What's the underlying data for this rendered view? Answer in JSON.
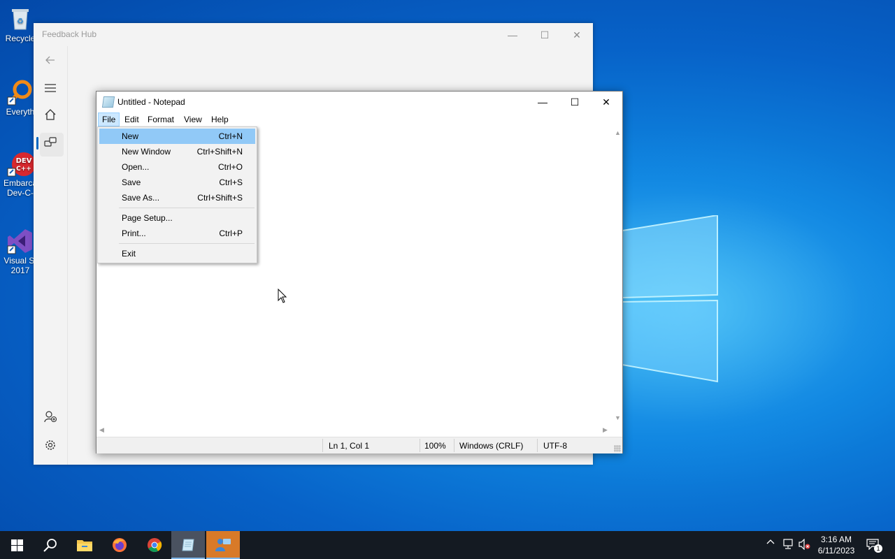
{
  "desktop": {
    "icons": [
      {
        "label": "Recycle",
        "icon": "recycle-bin-icon"
      },
      {
        "label": "Everyth",
        "icon": "everything-search-icon"
      },
      {
        "label": "Embarca",
        "label2": "Dev-C-",
        "icon": "devcpp-icon"
      },
      {
        "label": "Visual St",
        "label2": "2017",
        "icon": "visual-studio-icon"
      }
    ]
  },
  "feedback_hub": {
    "title": "Feedback Hub",
    "controls": {
      "minimize": "—",
      "maximize": "☐",
      "close": "✕"
    },
    "nav_icons": [
      "back-arrow-icon",
      "hamburger-menu-icon",
      "home-icon",
      "feedback-icon",
      "add-person-icon",
      "settings-gear-icon"
    ]
  },
  "notepad": {
    "title": "Untitled - Notepad",
    "controls": {
      "minimize": "—",
      "maximize": "☐",
      "close": "✕"
    },
    "menu": [
      "File",
      "Edit",
      "Format",
      "View",
      "Help"
    ],
    "active_menu": "File",
    "status": {
      "position": "Ln 1, Col 1",
      "zoom": "100%",
      "line_ending": "Windows (CRLF)",
      "encoding": "UTF-8"
    }
  },
  "file_menu": {
    "items": [
      {
        "label": "New",
        "shortcut": "Ctrl+N",
        "highlighted": true
      },
      {
        "label": "New Window",
        "shortcut": "Ctrl+Shift+N"
      },
      {
        "label": "Open...",
        "shortcut": "Ctrl+O"
      },
      {
        "label": "Save",
        "shortcut": "Ctrl+S"
      },
      {
        "label": "Save As...",
        "shortcut": "Ctrl+Shift+S"
      },
      {
        "label": "Page Setup...",
        "shortcut": ""
      },
      {
        "label": "Print...",
        "shortcut": "Ctrl+P"
      },
      {
        "label": "Exit",
        "shortcut": ""
      }
    ]
  },
  "taskbar": {
    "apps": [
      "start-icon",
      "search-icon",
      "file-explorer-icon",
      "firefox-icon",
      "chrome-icon",
      "notepad-icon",
      "feedback-hub-icon"
    ],
    "clock": {
      "time": "3:16 AM",
      "date": "6/11/2023"
    },
    "notification_count": "1"
  },
  "colors": {
    "menu_highlight": "#91c9f7",
    "menubar_active": "#cce8ff",
    "taskbar": "#141a22",
    "accent": "#0067c0"
  }
}
